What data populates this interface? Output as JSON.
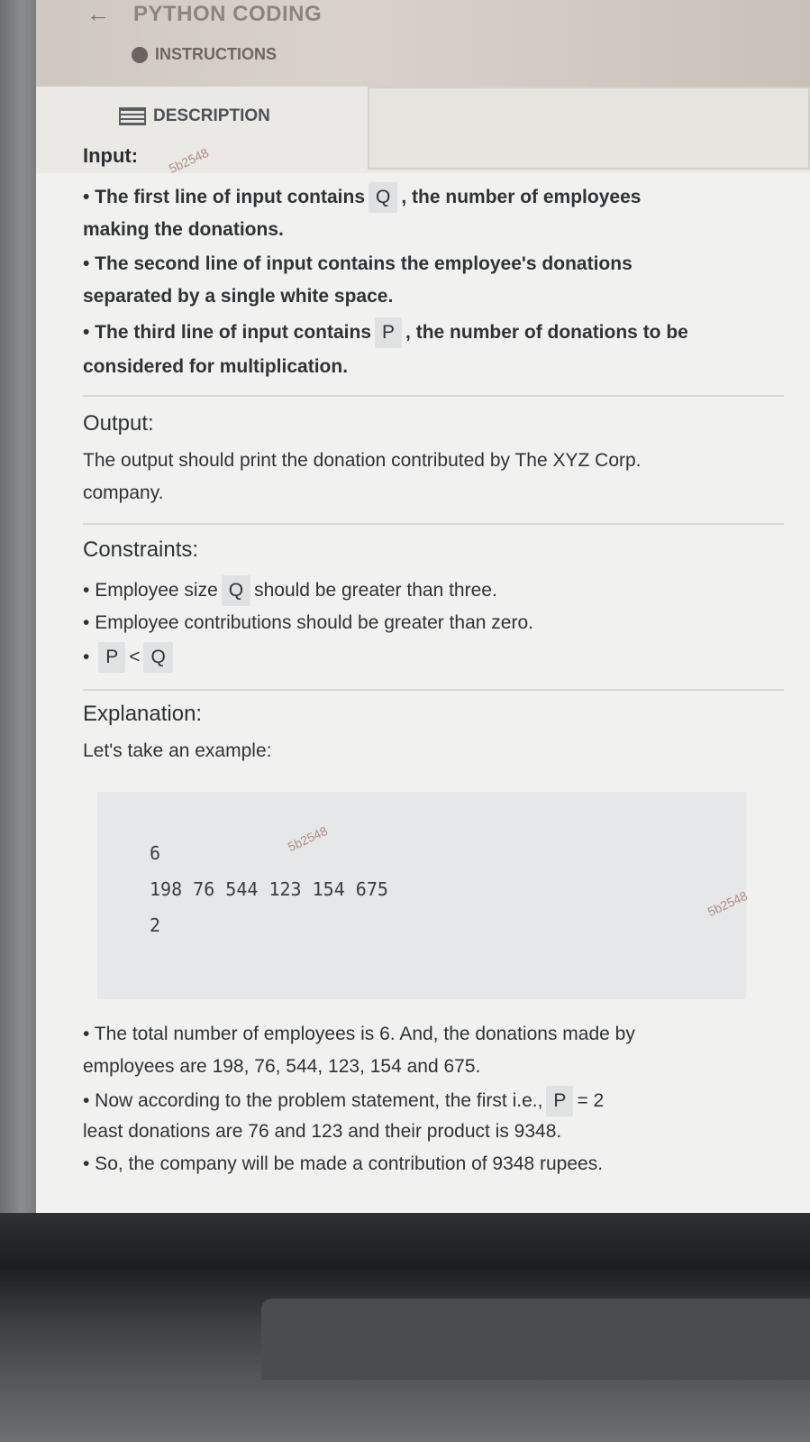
{
  "header": {
    "back_icon": "arrow-left-icon",
    "app_title": "PYTHON CODING",
    "instructions_label": "INSTRUCTIONS"
  },
  "tabs": {
    "description_label": "DESCRIPTION"
  },
  "input_section": {
    "heading": "Input:",
    "line1_pre": "• The first line of input contains",
    "line1_var": "Q",
    "line1_post": ", the number of employees",
    "line1_cont": "making the donations.",
    "line2": "• The second line of input contains the employee's donations",
    "line2_cont": "separated by a single white space.",
    "line3_pre": "• The third line of input contains",
    "line3_var": "P",
    "line3_post": ", the number of donations to be",
    "line3_cont": "considered for multiplication."
  },
  "output_section": {
    "heading": "Output:",
    "text1": "The output should print the donation contributed by The XYZ Corp.",
    "text2": "company."
  },
  "constraints_section": {
    "heading": "Constraints:",
    "c1_pre": "Employee size",
    "c1_var": "Q",
    "c1_post": "should be greater than three.",
    "c2": "Employee contributions should be greater than zero.",
    "c3_a": "P",
    "c3_op": "<",
    "c3_b": "Q"
  },
  "explanation_section": {
    "heading": "Explanation:",
    "intro": "Let's take an example:",
    "code_lines": [
      "6",
      "198 76 544 123 154 675",
      "2"
    ],
    "b1_a": "• The total number of employees is 6. And, the donations made by",
    "b1_b": "employees are 198, 76, 544, 123, 154 and 675.",
    "b2_pre": "• Now according to the problem statement, the first i.e.,",
    "b2_var": "P",
    "b2_post": "= 2",
    "b2_b": "least donations are 76 and 123 and their product is 9348.",
    "b3": "• So, the company will be made a contribution of 9348 rupees."
  },
  "watermark": "5b2548"
}
